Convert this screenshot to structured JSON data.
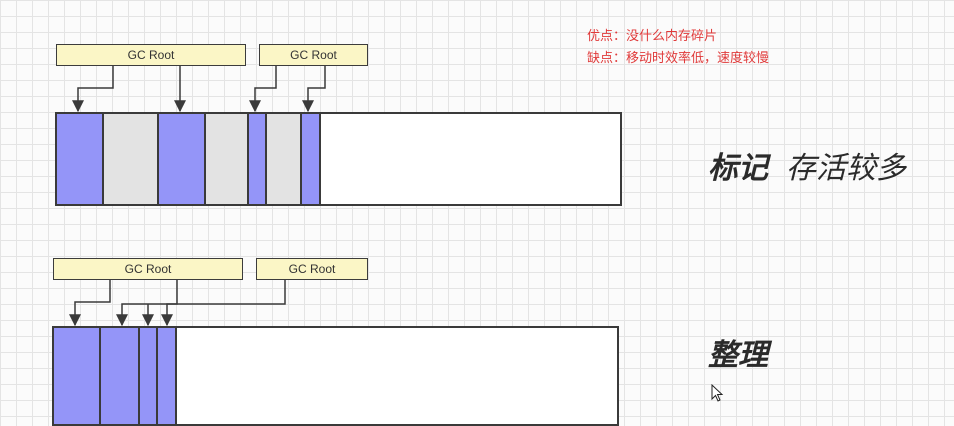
{
  "notes": {
    "pros": "优点：没什么内存碎片",
    "cons": "缺点：移动时效率低，速度较慢"
  },
  "mark_section": {
    "root_a": "GC Root",
    "root_b": "GC Root",
    "title": "标记",
    "subtitle": "存活较多"
  },
  "compact_section": {
    "root_a": "GC Root",
    "root_b": "GC Root",
    "title": "整理"
  },
  "colors": {
    "live_object": "#9495f8",
    "dead_object": "#e3e3e3",
    "free_space": "#ffffff",
    "gc_root_fill": "#fbf6c6",
    "notes_text": "#e03a3a"
  },
  "icons": {
    "cursor": "mouse-pointer-icon"
  }
}
